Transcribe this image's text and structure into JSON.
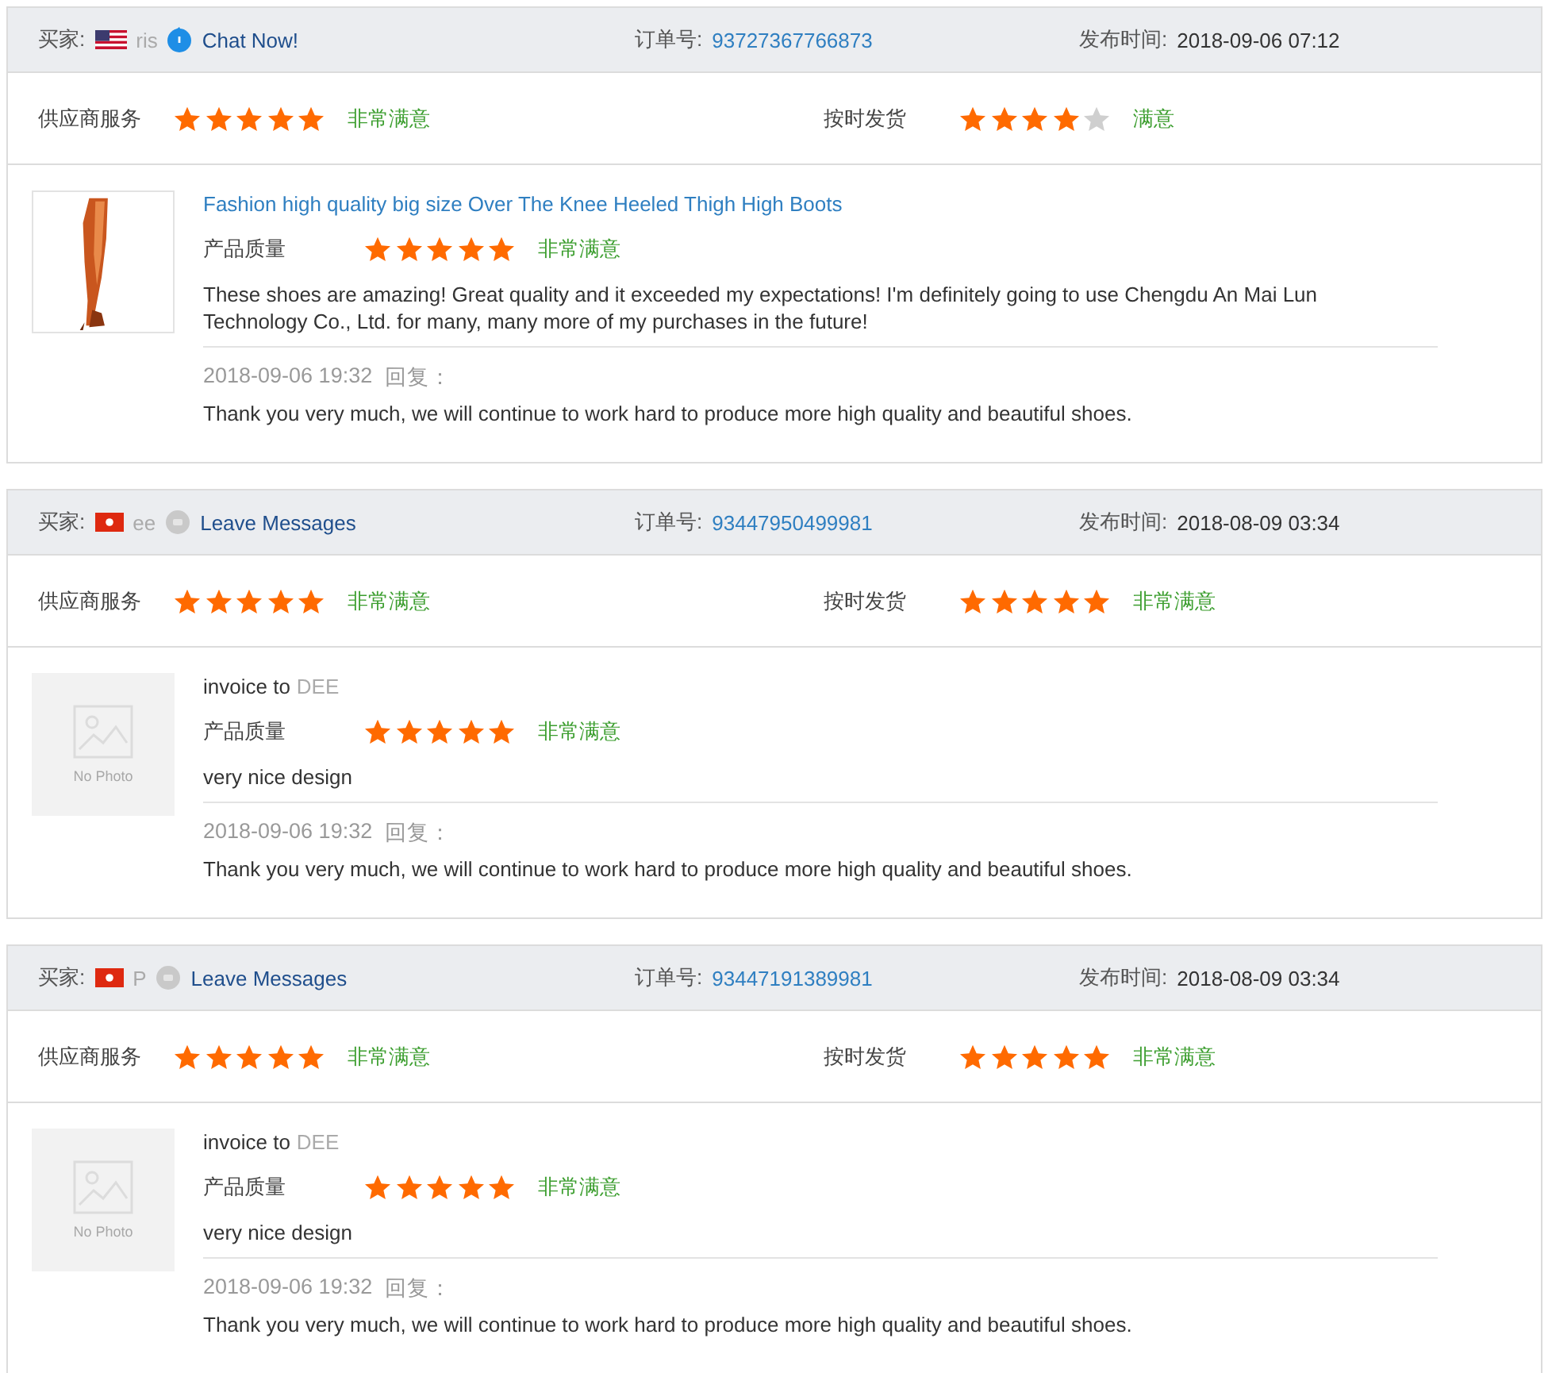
{
  "reviews": [
    {
      "buyer": {
        "label": "买家:",
        "flag": {
          "kind": "us"
        },
        "name": "ris",
        "contact": {
          "kind": "chat",
          "label": "Chat Now!"
        }
      },
      "order": {
        "label": "订单号:",
        "number": "93727367766873"
      },
      "published": {
        "label": "发布时间:",
        "time": "2018-09-06 07:12"
      },
      "ratings": [
        {
          "label": "供应商服务",
          "stars": 5,
          "verdict": "非常满意"
        },
        {
          "label": "按时发货",
          "stars": 4,
          "verdict": "满意"
        }
      ],
      "product": {
        "heading": {
          "kind": "link",
          "text": "Fashion high quality big size Over The Knee Heeled Thigh High Boots"
        },
        "quality": {
          "label": "产品质量",
          "stars": 5,
          "verdict": "非常满意"
        },
        "comment": "These shoes are amazing! Great quality and it exceeded my expectations! I'm definitely going to use Chengdu An Mai Lun Technology Co., Ltd. for many, many more of my purchases in the future!",
        "reply": {
          "date": "2018-09-06 19:32",
          "label": "回复：",
          "text": "Thank you very much, we will continue to work hard to produce more high quality and beautiful shoes."
        }
      }
    },
    {
      "buyer": {
        "label": "买家:",
        "flag": {
          "kind": "hk"
        },
        "name": "ee",
        "contact": {
          "kind": "message",
          "label": "Leave Messages"
        }
      },
      "order": {
        "label": "订单号:",
        "number": "93447950499981"
      },
      "published": {
        "label": "发布时间:",
        "time": "2018-08-09 03:34"
      },
      "ratings": [
        {
          "label": "供应商服务",
          "stars": 5,
          "verdict": "非常满意"
        },
        {
          "label": "按时发货",
          "stars": 5,
          "verdict": "非常满意"
        }
      ],
      "product": {
        "image": {
          "kind": "placeholder",
          "text": "No Photo"
        },
        "heading": {
          "kind": "note",
          "text": "invoice to",
          "name": "DEE"
        },
        "quality": {
          "label": "产品质量",
          "stars": 5,
          "verdict": "非常满意"
        },
        "comment": "very nice design",
        "reply": {
          "date": "2018-09-06 19:32",
          "label": "回复：",
          "text": "Thank you very much, we will continue to work hard to produce more high quality and beautiful shoes."
        }
      }
    },
    {
      "buyer": {
        "label": "买家:",
        "flag": {
          "kind": "hk"
        },
        "name": "P",
        "contact": {
          "kind": "message",
          "label": "Leave Messages"
        }
      },
      "order": {
        "label": "订单号:",
        "number": "93447191389981"
      },
      "published": {
        "label": "发布时间:",
        "time": "2018-08-09 03:34"
      },
      "ratings": [
        {
          "label": "供应商服务",
          "stars": 5,
          "verdict": "非常满意"
        },
        {
          "label": "按时发货",
          "stars": 5,
          "verdict": "非常满意"
        }
      ],
      "product": {
        "image": {
          "kind": "placeholder",
          "text": "No Photo"
        },
        "heading": {
          "kind": "note",
          "text": "invoice to",
          "name": "DEE"
        },
        "quality": {
          "label": "产品质量",
          "stars": 5,
          "verdict": "非常满意"
        },
        "comment": "very nice design",
        "reply": {
          "date": "2018-09-06 19:32",
          "label": "回复：",
          "text": "Thank you very much, we will continue to work hard to produce more high quality and beautiful shoes."
        }
      }
    }
  ]
}
